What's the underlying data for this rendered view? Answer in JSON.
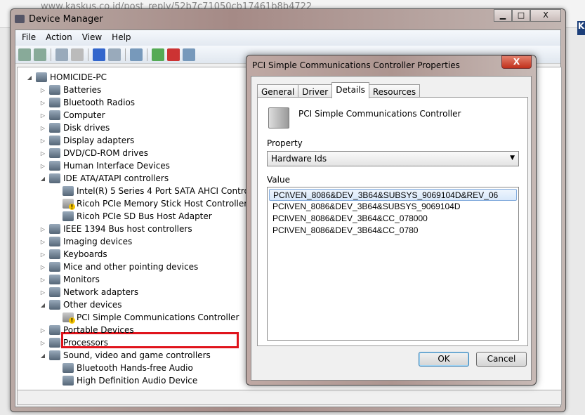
{
  "browser": {
    "url": "www.kaskus.co.id/post_reply/52b7c71050cb17461b8b4722",
    "badge": "K"
  },
  "window": {
    "title": "Device Manager",
    "min": "▁",
    "max": "□",
    "close": "X"
  },
  "menu": [
    "File",
    "Action",
    "View",
    "Help"
  ],
  "toolbar": [
    "back-icon",
    "forward-icon",
    "show-hide-console-tree-icon",
    "properties-icon",
    "help-icon",
    "action-pane-icon",
    "scan-hardware-icon",
    "update-driver-icon",
    "uninstall-icon",
    "disable-icon"
  ],
  "tree": [
    {
      "label": "HOMICIDE-PC",
      "level": 0,
      "exp": "◢"
    },
    {
      "label": "Batteries",
      "level": 1,
      "exp": "▷"
    },
    {
      "label": "Bluetooth Radios",
      "level": 1,
      "exp": "▷"
    },
    {
      "label": "Computer",
      "level": 1,
      "exp": "▷"
    },
    {
      "label": "Disk drives",
      "level": 1,
      "exp": "▷"
    },
    {
      "label": "Display adapters",
      "level": 1,
      "exp": "▷"
    },
    {
      "label": "DVD/CD-ROM drives",
      "level": 1,
      "exp": "▷"
    },
    {
      "label": "Human Interface Devices",
      "level": 1,
      "exp": "▷"
    },
    {
      "label": "IDE ATA/ATAPI controllers",
      "level": 1,
      "exp": "◢"
    },
    {
      "label": "Intel(R) 5 Series 4 Port SATA AHCI Controller",
      "level": 2,
      "exp": ""
    },
    {
      "label": "Ricoh PCIe Memory Stick Host Controller",
      "level": 2,
      "exp": "",
      "warn": true
    },
    {
      "label": "Ricoh PCIe SD Bus Host Adapter",
      "level": 2,
      "exp": ""
    },
    {
      "label": "IEEE 1394 Bus host controllers",
      "level": 1,
      "exp": "▷"
    },
    {
      "label": "Imaging devices",
      "level": 1,
      "exp": "▷"
    },
    {
      "label": "Keyboards",
      "level": 1,
      "exp": "▷"
    },
    {
      "label": "Mice and other pointing devices",
      "level": 1,
      "exp": "▷"
    },
    {
      "label": "Monitors",
      "level": 1,
      "exp": "▷"
    },
    {
      "label": "Network adapters",
      "level": 1,
      "exp": "▷"
    },
    {
      "label": "Other devices",
      "level": 1,
      "exp": "◢"
    },
    {
      "label": "PCI Simple Communications Controller",
      "level": 2,
      "exp": "",
      "warn": true
    },
    {
      "label": "Portable Devices",
      "level": 1,
      "exp": "▷"
    },
    {
      "label": "Processors",
      "level": 1,
      "exp": "▷"
    },
    {
      "label": "Sound, video and game controllers",
      "level": 1,
      "exp": "◢"
    },
    {
      "label": "Bluetooth Hands-free Audio",
      "level": 2,
      "exp": ""
    },
    {
      "label": "High Definition Audio Device",
      "level": 2,
      "exp": ""
    }
  ],
  "dialog": {
    "title": "PCI Simple Communications Controller Properties",
    "close": "X",
    "tabs": [
      "General",
      "Driver",
      "Details",
      "Resources"
    ],
    "active_tab": "Details",
    "device_name": "PCI Simple Communications Controller",
    "property_label": "Property",
    "property_value": "Hardware Ids",
    "value_label": "Value",
    "values": [
      "PCI\\VEN_8086&DEV_3B64&SUBSYS_9069104D&REV_06",
      "PCI\\VEN_8086&DEV_3B64&SUBSYS_9069104D",
      "PCI\\VEN_8086&DEV_3B64&CC_078000",
      "PCI\\VEN_8086&DEV_3B64&CC_0780"
    ],
    "ok": "OK",
    "cancel": "Cancel"
  },
  "colors": {
    "highlight_box": "#e0141c",
    "selection": "#d8e8fa"
  }
}
